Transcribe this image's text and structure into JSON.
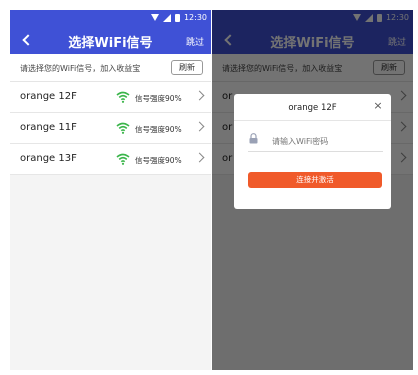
{
  "status": {
    "time": "12:30"
  },
  "nav": {
    "title": "选择WiFi信号",
    "skip": "跳过"
  },
  "hint": {
    "text": "请选择您的WiFi信号，加入收益宝",
    "refresh": "刷新"
  },
  "networks": [
    {
      "ssid": "orange 12F",
      "strength": "信号强度90%"
    },
    {
      "ssid": "orange 11F",
      "strength": "信号强度90%"
    },
    {
      "ssid": "orange 13F",
      "strength": "信号强度90%"
    }
  ],
  "right_networks": [
    {
      "ssid": "or"
    },
    {
      "ssid": "or"
    },
    {
      "ssid": "or"
    }
  ],
  "dialog": {
    "title": "orange 12F",
    "close": "×",
    "password_placeholder": "请输入WiFi密码",
    "activate_label": "连接并激活"
  },
  "colors": {
    "primary": "#3f51d6",
    "accent": "#f05a2a",
    "wifi": "#3ab54a"
  }
}
